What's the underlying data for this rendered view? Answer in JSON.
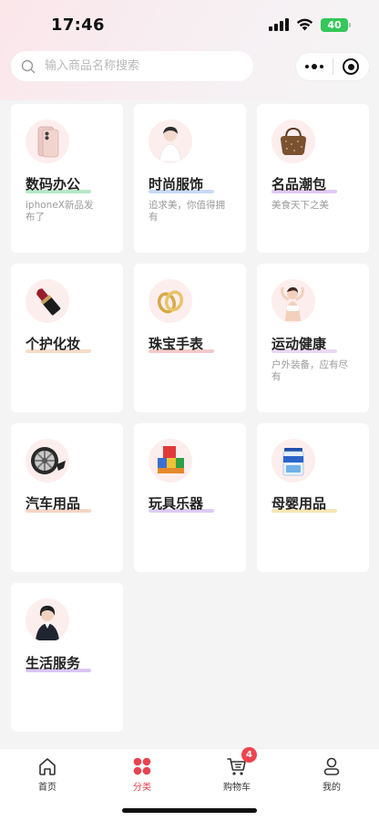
{
  "status": {
    "time": "17:46",
    "battery": "40"
  },
  "search": {
    "placeholder": "输入商品名称搜索"
  },
  "categories": [
    {
      "name": "数码办公",
      "desc": "iphoneX新品发布了",
      "icon": "smartphone-icon",
      "bar_color": "#b5e8c8"
    },
    {
      "name": "时尚服饰",
      "desc": "追求美，你值得拥有",
      "icon": "fashion-model-icon",
      "bar_color": "#c9d9f7"
    },
    {
      "name": "名品潮包",
      "desc": "美食天下之美",
      "icon": "handbag-icon",
      "bar_color": "#e1c9f2"
    },
    {
      "name": "个护化妆",
      "desc": "",
      "icon": "lipstick-icon",
      "bar_color": "#f6dcc8"
    },
    {
      "name": "珠宝手表",
      "desc": "",
      "icon": "rings-icon",
      "bar_color": "#f5c9c9"
    },
    {
      "name": "运动健康",
      "desc": "户外装备，应有尽有",
      "icon": "fitness-woman-icon",
      "bar_color": "#ead7f4"
    },
    {
      "name": "汽车用品",
      "desc": "",
      "icon": "car-wheel-icon",
      "bar_color": "#f5d5c6"
    },
    {
      "name": "玩具乐器",
      "desc": "",
      "icon": "toy-blocks-icon",
      "bar_color": "#dccbf5"
    },
    {
      "name": "母婴用品",
      "desc": "",
      "icon": "milk-powder-icon",
      "bar_color": "#f7e6b5"
    },
    {
      "name": "生活服务",
      "desc": "",
      "icon": "service-agent-icon",
      "bar_color": "#d9c7f2"
    }
  ],
  "tabbar": {
    "items": [
      {
        "label": "首页",
        "icon": "home-icon"
      },
      {
        "label": "分类",
        "icon": "category-icon"
      },
      {
        "label": "购物车",
        "icon": "cart-icon",
        "badge": "4"
      },
      {
        "label": "我的",
        "icon": "user-icon"
      }
    ],
    "active_color": "#e8434f"
  }
}
